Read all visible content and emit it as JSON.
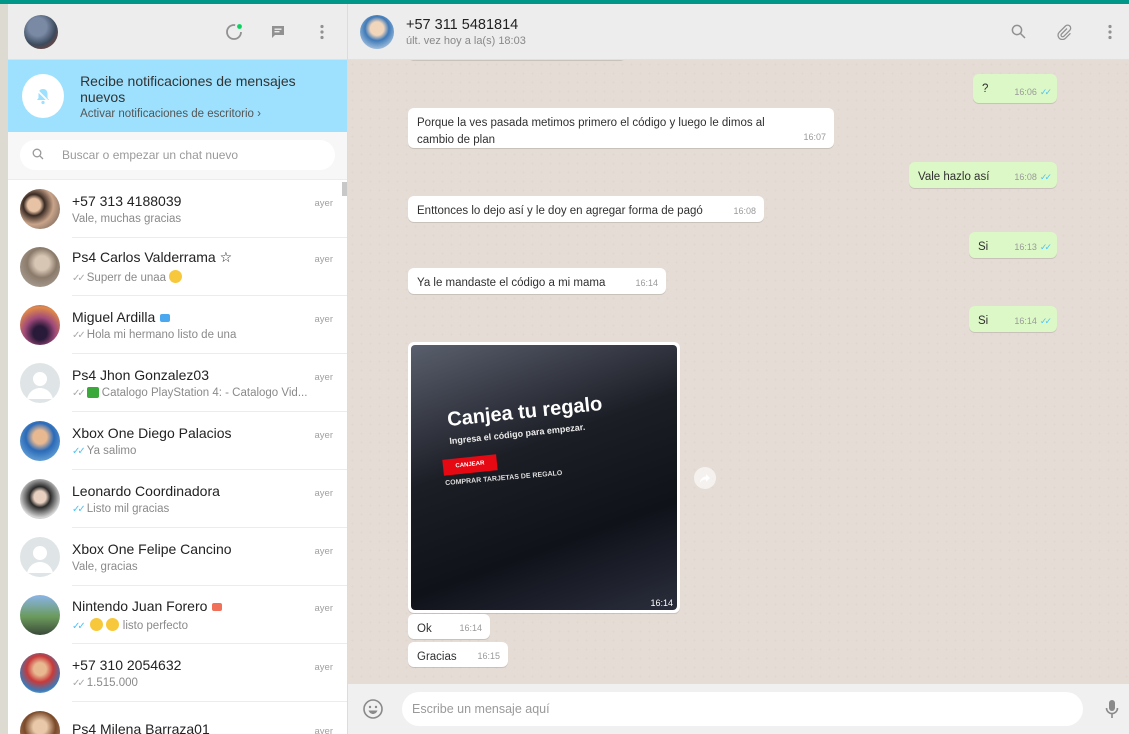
{
  "sidebar": {
    "notification": {
      "title": "Recibe notificaciones de mensajes nuevos",
      "link": "Activar notificaciones de escritorio ›"
    },
    "search": {
      "placeholder": "Buscar o empezar un chat nuevo"
    },
    "chats": [
      {
        "name": "+57 313 4188039",
        "time": "ayer",
        "last": "Vale, muchas gracias",
        "check": ""
      },
      {
        "name": "Ps4 Carlos Valderrama ☆",
        "time": "ayer",
        "last": "Superr de unaa",
        "check": "grey"
      },
      {
        "name": "Miguel Ardilla",
        "time": "ayer",
        "last": "Hola mi hermano listo de una",
        "check": "grey"
      },
      {
        "name": "Ps4 Jhon Gonzalez03",
        "time": "ayer",
        "last": "Catalogo PlayStation 4: - Catalogo Vid...",
        "check": "grey"
      },
      {
        "name": "Xbox One Diego Palacios",
        "time": "ayer",
        "last": "Ya salimo",
        "check": "blue"
      },
      {
        "name": "Leonardo Coordinadora",
        "time": "ayer",
        "last": "Listo mil gracias",
        "check": "blue"
      },
      {
        "name": "Xbox One Felipe Cancino",
        "time": "ayer",
        "last": "Vale, gracias",
        "check": ""
      },
      {
        "name": "Nintendo Juan Forero",
        "time": "ayer",
        "last": "listo perfecto",
        "check": "blue"
      },
      {
        "name": "+57 310 2054632",
        "time": "ayer",
        "last": "1.515.000",
        "check": "grey"
      },
      {
        "name": "Ps4 Milena Barraza01",
        "time": "ayer",
        "last": "",
        "check": ""
      }
    ]
  },
  "conversation": {
    "contact_name": "+57 311 5481814",
    "contact_status": "últ. vez hoy a la(s) 18:03",
    "messages": [
      {
        "dir": "out",
        "text": "?",
        "time": "16:06"
      },
      {
        "dir": "in",
        "text": "Porque la ves pasada metimos primero el código y luego le dimos al cambio de plan",
        "time": "16:07"
      },
      {
        "dir": "out",
        "text": "Vale hazlo así",
        "time": "16:08"
      },
      {
        "dir": "in",
        "text": "Enttonces lo dejo así y le doy en agregar forma de pagó",
        "time": "16:08"
      },
      {
        "dir": "out",
        "text": "Si",
        "time": "16:13"
      },
      {
        "dir": "in",
        "text": "Ya le mandaste el código a mi mama",
        "time": "16:14"
      },
      {
        "dir": "out",
        "text": "Si",
        "time": "16:14"
      },
      {
        "dir": "in",
        "type": "image",
        "time": "16:14",
        "image_text": {
          "title": "Canjea tu regalo",
          "subtitle": "Ingresa el código para empezar.",
          "button": "CANJEAR",
          "strip": "COMPRAR TARJETAS DE REGALO"
        }
      },
      {
        "dir": "in",
        "text": "Ok",
        "time": "16:14"
      },
      {
        "dir": "in",
        "text": "Gracias",
        "time": "16:15"
      }
    ],
    "composer_placeholder": "Escribe un mensaje aquí"
  }
}
